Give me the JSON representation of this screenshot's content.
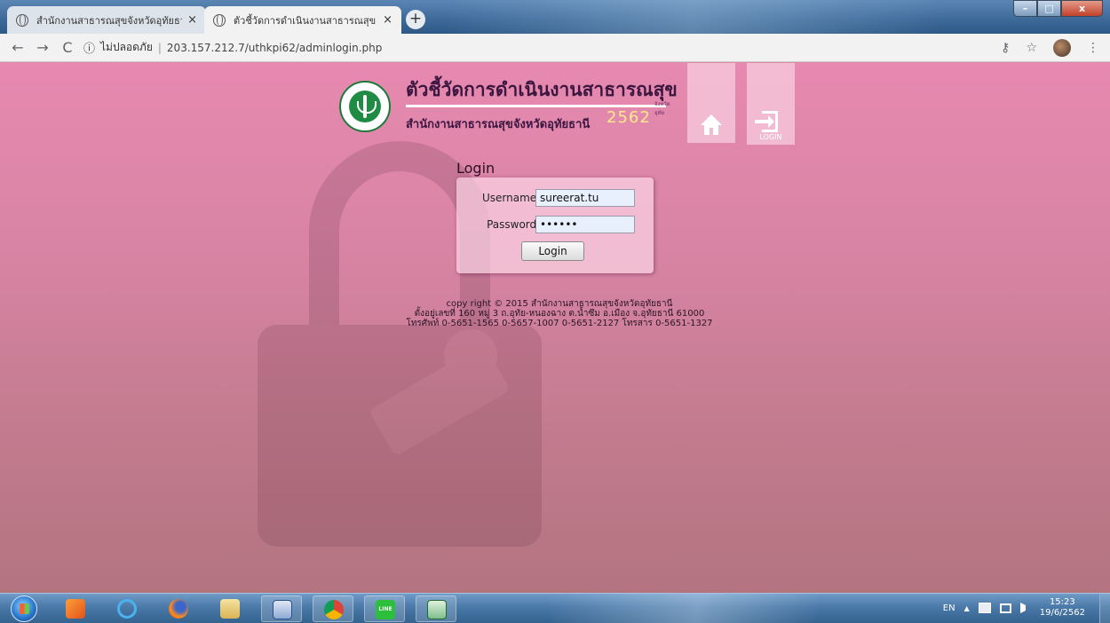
{
  "browser": {
    "tabs": [
      {
        "title": "สำนักงานสาธารณสุขจังหวัดอุทัยธานี",
        "close": "×"
      },
      {
        "title": "ตัวชี้วัดการดำเนินงานสาธารณสุข สำนัก",
        "close": "×"
      }
    ],
    "new_tab": "+",
    "window_controls": {
      "minimize": "–",
      "maximize": "□",
      "close": "x"
    },
    "nav": {
      "back": "←",
      "forward": "→",
      "reload": "C"
    },
    "address": {
      "info_icon": "ⓘ",
      "security": "ไม่ปลอดภัย",
      "separator": "|",
      "url": "203.157.212.7/uthkpi62/adminlogin.php"
    },
    "toolbar_icons": {
      "key": "⚷",
      "star": "☆",
      "menu": "⋮"
    }
  },
  "header": {
    "title": "ตัวชี้วัดการดำเนินงานสาธารณสุข",
    "tagline": "จังหวัดอุทัย",
    "subtitle": "สำนักงานสาธารณสุขจังหวัดอุทัยธานี",
    "year": "2562",
    "login_tile_label": "LOGIN"
  },
  "login": {
    "heading": "Login",
    "username_label": "Username :",
    "username_value": "sureerat.tu",
    "password_label": "Password :",
    "password_value": "••••••",
    "submit_label": "Login"
  },
  "footer": {
    "line1": "copy right © 2015 สำนักงานสาธารณสุขจังหวัดอุทัยธานี",
    "line2": "ตั้งอยู่เลขที่ 160 หมู่ 3 ถ.อุทัย-หนองฉาง ต.น้ำซึม อ.เมือง จ.อุทัยธานี 61000",
    "line3": "โทรศัพท์ 0-5651-1565 0-5657-1007 0-5651-2127 โทรสาร 0-5651-1327"
  },
  "taskbar": {
    "apps": [
      "media-player-icon",
      "internet-explorer-icon",
      "firefox-icon",
      "file-explorer-icon",
      "word-icon",
      "chrome-icon",
      "line-icon",
      "excel-icon"
    ],
    "line_app_label": "LINE",
    "tray": {
      "language": "EN",
      "expand": "▲"
    },
    "time": "15:23",
    "date": "19/6/2562"
  },
  "colors": {
    "page_top": "#e789b0",
    "page_bottom": "#b37480",
    "title_text": "#3b1640",
    "year_text": "#ffe98a",
    "taskbar": "#4b79a8"
  }
}
